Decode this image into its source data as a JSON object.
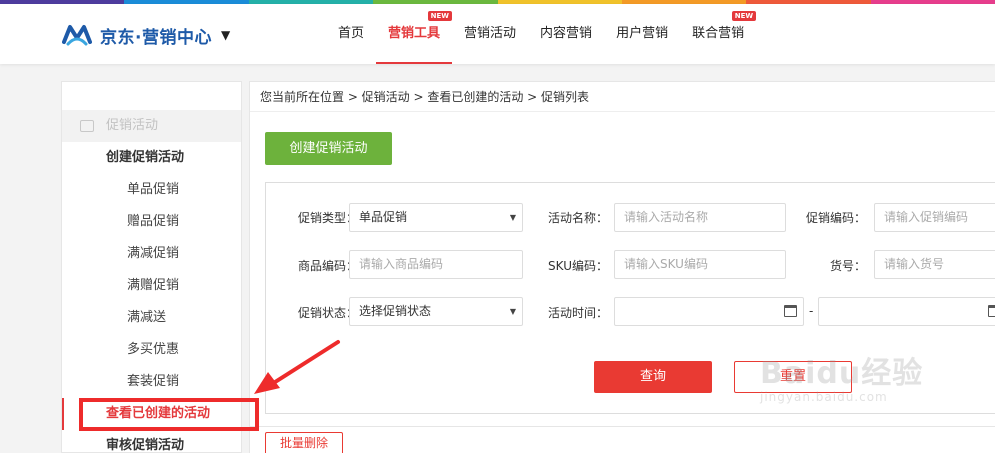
{
  "colors": {
    "strip": [
      "#4e3c9e",
      "#1b8cd8",
      "#24b0a8",
      "#6bb83f",
      "#f0c22a",
      "#f39a26",
      "#ee5a3a",
      "#e63d8c"
    ],
    "brand": "#1e5aa8",
    "accent": "#e4393c",
    "create_button": "#6db23c"
  },
  "header": {
    "logo_text": "京东·营销中心",
    "logo_caret": "▼",
    "nav": [
      {
        "label": "首页",
        "badge": ""
      },
      {
        "label": "营销工具",
        "badge": "NEW",
        "active": true
      },
      {
        "label": "营销活动",
        "badge": ""
      },
      {
        "label": "内容营销",
        "badge": ""
      },
      {
        "label": "用户营销",
        "badge": ""
      },
      {
        "label": "联合营销",
        "badge": "NEW"
      }
    ]
  },
  "sidebar": {
    "group": "促销活动",
    "sections": [
      {
        "title": "创建促销活动",
        "items": [
          "单品促销",
          "赠品促销",
          "满减促销",
          "满赠促销",
          "满减送",
          "多买优惠",
          "套装促销"
        ]
      }
    ],
    "active_item": "查看已创建的活动",
    "next_section": "审核促销活动"
  },
  "main": {
    "breadcrumb": "您当前所在位置 > 促销活动 > 查看已创建的活动 > 促销列表",
    "create_button": "创建促销活动",
    "filters": {
      "promo_type": {
        "label": "促销类型：",
        "value": "单品促销"
      },
      "activity_name": {
        "label": "活动名称：",
        "placeholder": "请输入活动名称"
      },
      "promo_code": {
        "label": "促销编码：",
        "placeholder": "请输入促销编码"
      },
      "product_code": {
        "label": "商品编码：",
        "placeholder": "请输入商品编码"
      },
      "sku_code": {
        "label": "SKU编码：",
        "placeholder": "请输入SKU编码"
      },
      "item_no": {
        "label": "货号：",
        "placeholder": "请输入货号"
      },
      "promo_status": {
        "label": "促销状态：",
        "value": "选择促销状态"
      },
      "activity_time": {
        "label": "活动时间：",
        "separator": "-"
      }
    },
    "query_button": "查询",
    "reset_button": "重置",
    "batch_delete_button": "批量删除"
  },
  "watermark": {
    "main": "Baidu经验",
    "sub": "jingyan.baidu.com"
  }
}
